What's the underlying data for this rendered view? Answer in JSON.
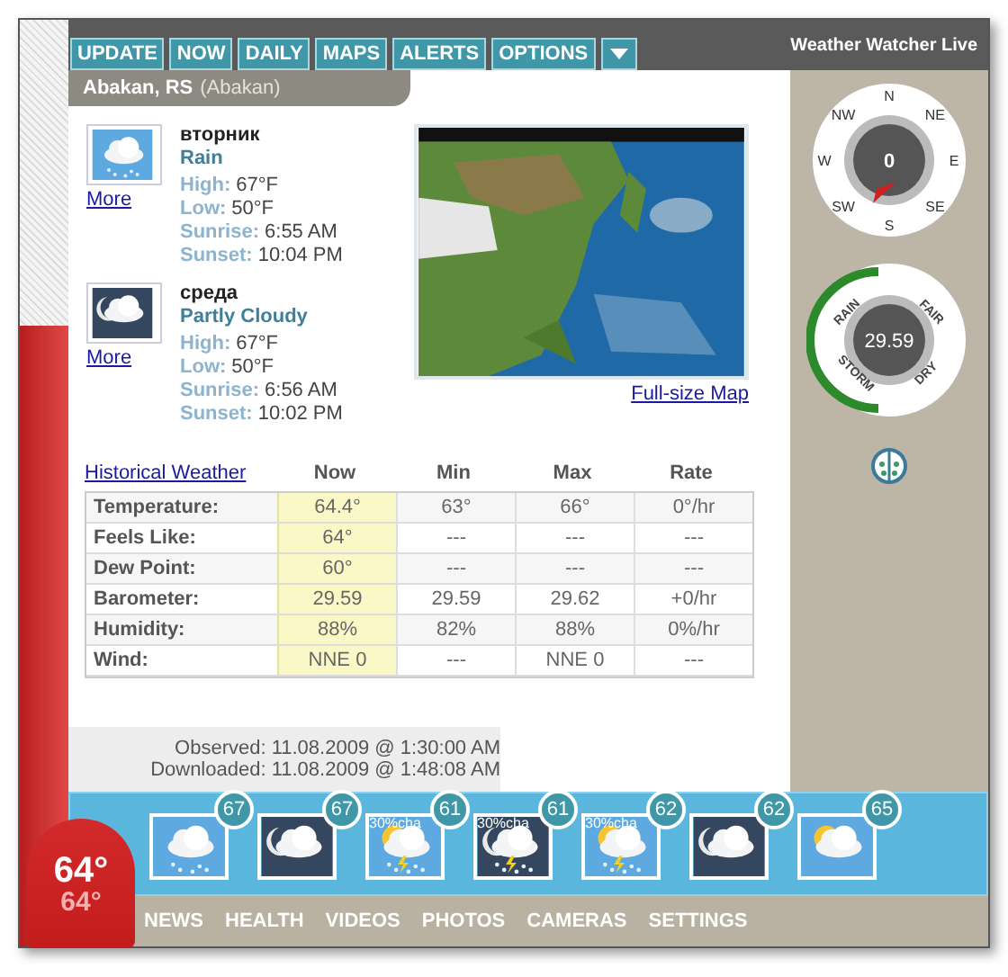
{
  "app_title": "Weather Watcher Live",
  "tabs": [
    {
      "label": "UPDATE"
    },
    {
      "label": "NOW"
    },
    {
      "label": "DAILY"
    },
    {
      "label": "MAPS"
    },
    {
      "label": "ALERTS"
    },
    {
      "label": "OPTIONS"
    }
  ],
  "location": {
    "name": "Abakan, RS",
    "detail": "(Abakan)"
  },
  "days": [
    {
      "kind": "rain",
      "day": "вторник",
      "condition": "Rain",
      "more": "More",
      "fields": [
        {
          "label": "High:",
          "value": "67°F"
        },
        {
          "label": "Low:",
          "value": "50°F"
        },
        {
          "label": "Sunrise:",
          "value": "6:55 AM"
        },
        {
          "label": "Sunset:",
          "value": "10:04 PM"
        }
      ]
    },
    {
      "kind": "night-cloudy",
      "day": "среда",
      "condition": "Partly Cloudy",
      "more": "More",
      "fields": [
        {
          "label": "High:",
          "value": "67°F"
        },
        {
          "label": "Low:",
          "value": "50°F"
        },
        {
          "label": "Sunrise:",
          "value": "6:56 AM"
        },
        {
          "label": "Sunset:",
          "value": "10:02 PM"
        }
      ]
    }
  ],
  "map": {
    "kind": "picture",
    "link": "Full-size Map"
  },
  "compass": {
    "points": [
      "N",
      "NE",
      "E",
      "SE",
      "S",
      "SW",
      "W",
      "NW"
    ],
    "speed": "0"
  },
  "barometer": {
    "labels": [
      "RAIN",
      "FAIR",
      "STORM",
      "DRY"
    ],
    "reading": "29.59"
  },
  "table": {
    "link": "Historical Weather",
    "columns": [
      {
        "label": "Now",
        "highlighted": true
      },
      {
        "label": "Min",
        "highlighted": false
      },
      {
        "label": "Max",
        "highlighted": false
      },
      {
        "label": "Rate",
        "highlighted": false
      }
    ],
    "rows": [
      {
        "label": "Temperature:",
        "cells": [
          "64.4°",
          "63°",
          "66°",
          "0°/hr"
        ]
      },
      {
        "label": "Feels Like:",
        "cells": [
          "64°",
          "---",
          "---",
          "---"
        ]
      },
      {
        "label": "Dew Point:",
        "cells": [
          "60°",
          "---",
          "---",
          "---"
        ]
      },
      {
        "label": "Barometer:",
        "cells": [
          "29.59",
          "29.59",
          "29.62",
          "+0/hr"
        ]
      },
      {
        "label": "Humidity:",
        "cells": [
          "88%",
          "82%",
          "88%",
          "0%/hr"
        ]
      },
      {
        "label": "Wind:",
        "cells": [
          "NNE 0",
          "---",
          "NNE 0",
          "---"
        ]
      }
    ]
  },
  "observed": "Observed: 11.08.2009 @ 1:30:00 AM",
  "downloaded": "Downloaded: 11.08.2009 @ 1:48:08 AM",
  "current_temp": "64°",
  "feels_temp": "64°",
  "forecast": [
    {
      "kind": "rain",
      "temp": "67"
    },
    {
      "kind": "night-cloudy",
      "temp": "67"
    },
    {
      "kind": "storm",
      "temp": "61",
      "chance": "30%cha"
    },
    {
      "kind": "night-storm",
      "temp": "61",
      "chance": "30%cha"
    },
    {
      "kind": "storm",
      "temp": "62",
      "chance": "30%cha"
    },
    {
      "kind": "night-cloudy",
      "temp": "62"
    },
    {
      "kind": "partly-sunny",
      "temp": "65"
    }
  ],
  "nav": [
    "NEWS",
    "HEALTH",
    "VIDEOS",
    "PHOTOS",
    "CAMERAS",
    "SETTINGS"
  ]
}
